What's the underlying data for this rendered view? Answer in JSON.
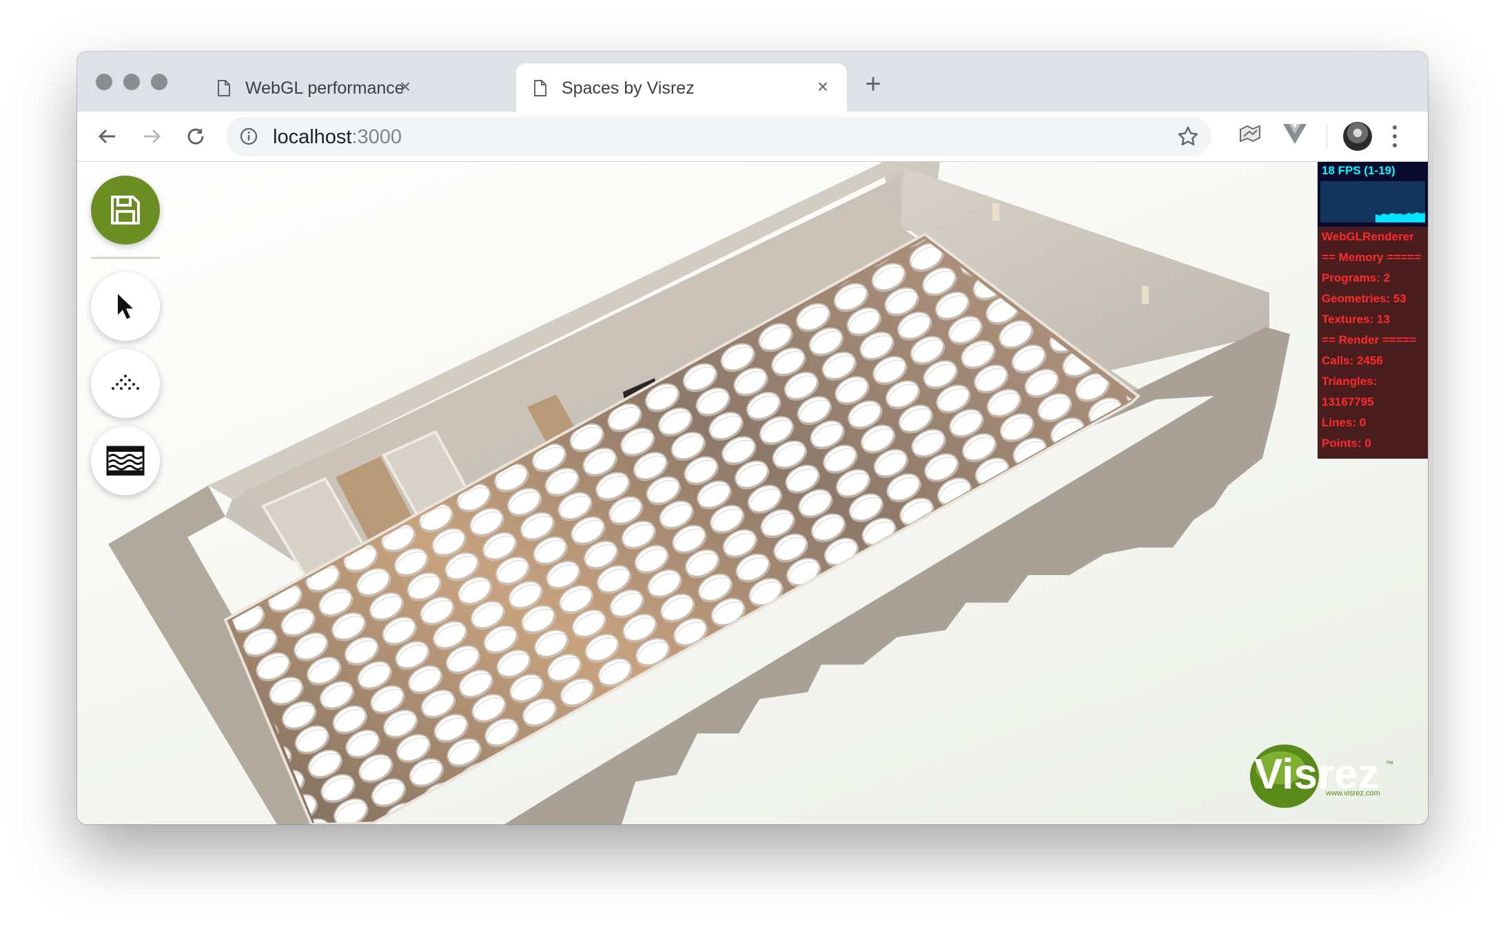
{
  "browser": {
    "tabs": [
      {
        "title": "WebGL performance",
        "icon": "document-icon",
        "active": false
      },
      {
        "title": "Spaces by Visrez",
        "icon": "document-icon",
        "active": true
      }
    ],
    "close_glyph": "×",
    "new_tab_glyph": "+",
    "address": {
      "host": "localhost",
      "port": ":3000"
    },
    "extensions": [
      "map-extension-icon",
      "vue-devtools-icon"
    ]
  },
  "tools": [
    {
      "name": "save-button",
      "icon": "floppy-disk-icon",
      "accent": "#6b8e23"
    },
    {
      "name": "select-tool-button",
      "icon": "cursor-arrow-icon"
    },
    {
      "name": "arrange-tables-button",
      "icon": "dot-pattern-icon"
    },
    {
      "name": "carpet-pattern-button",
      "icon": "carpet-pattern-icon"
    }
  ],
  "stats": {
    "fps": "18 FPS (1-19)",
    "renderer": "WebGLRenderer",
    "memory_header": "== Memory =====",
    "programs": "Programs: 2",
    "geometries": "Geometries: 53",
    "textures": "Textures: 13",
    "render_header": "== Render =====",
    "calls": "Calls: 2456",
    "triangles_label": "Triangles:",
    "triangles_value": "13167795",
    "lines": "Lines: 0",
    "points": "Points: 0",
    "colors": {
      "fps": "#00ffff",
      "info": "#ff2a2a",
      "fps_bg": "#0a0a2e",
      "info_bg": "#4a1d1f"
    }
  },
  "logo": {
    "brand": "Visrez",
    "trademark": "™",
    "url": "www.visrez.com",
    "color": "#5a8a1a"
  }
}
